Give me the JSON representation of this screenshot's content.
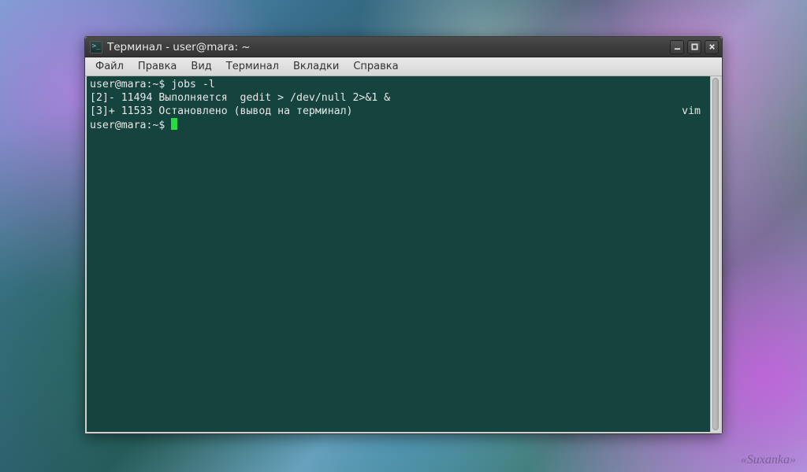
{
  "window": {
    "title": "Терминал - user@mara: ~"
  },
  "menubar": {
    "items": [
      "Файл",
      "Правка",
      "Вид",
      "Терминал",
      "Вкладки",
      "Справка"
    ]
  },
  "terminal": {
    "prompt": "user@mara:~$ ",
    "lines": [
      {
        "type": "cmd",
        "prompt": "user@mara:~$ ",
        "text": "jobs -l"
      },
      {
        "type": "out",
        "text": "[2]- 11494 Выполняется  gedit > /dev/null 2>&1 &"
      },
      {
        "type": "out_right",
        "left": "[3]+ 11533 Остановлено (вывод на терминал)",
        "right": "vim"
      },
      {
        "type": "prompt",
        "prompt": "user@mara:~$ "
      }
    ]
  },
  "watermark": "«Suxanka»"
}
